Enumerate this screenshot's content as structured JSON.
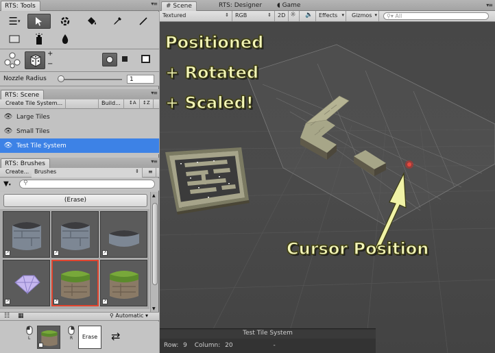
{
  "tools_panel": {
    "tab": "RTS: Tools",
    "nozzle_label": "Nozzle Radius",
    "nozzle_value": "1",
    "nozzle_level": 0.0
  },
  "scene_panel": {
    "tab": "RTS: Scene",
    "create_button": "Create Tile System...",
    "build_button": "Build...",
    "items": [
      {
        "label": "Large Tiles",
        "selected": false
      },
      {
        "label": "Small Tiles",
        "selected": false
      },
      {
        "label": "Test Tile System",
        "selected": true
      }
    ]
  },
  "brushes_panel": {
    "tab": "RTS: Brushes",
    "create_button": "Create...",
    "category_dropdown": "Brushes",
    "erase_button": "(Erase)",
    "view_mode": "Automatic",
    "slot_left_label": "L",
    "slot_right_label": "R",
    "erase_slot_label": "Erase"
  },
  "right_tabs": [
    {
      "label": "Scene",
      "active": true
    },
    {
      "label": "RTS: Designer",
      "active": false
    },
    {
      "label": "Game",
      "active": false
    }
  ],
  "scene_toolbar": {
    "shading": "Textured",
    "channel": "RGB",
    "mode_2d": "2D",
    "effects": "Effects",
    "gizmos": "Gizmos",
    "search_placeholder": "All"
  },
  "captions": {
    "line1": "Positioned",
    "line2": "+ Rotated",
    "line3": "+ Scaled!",
    "cursor": "Cursor Position"
  },
  "status": {
    "title": "Test Tile System",
    "row_label": "Row:",
    "row_value": "9",
    "column_label": "Column:",
    "column_value": "20",
    "extra": "-"
  },
  "colors": {
    "selection": "#3d82e6",
    "caption_fill": "#f4f6b8",
    "brush_selected_outline": "#e2442e",
    "cursor_marker": "#d2302c"
  },
  "icons": [
    "hamburger-menu-icon",
    "pointer-select-icon",
    "paint-brush-icon",
    "bucket-fill-icon",
    "eyedropper-icon",
    "line-tool-icon",
    "rectangle-tool-icon",
    "spray-icon",
    "drop-icon",
    "cycle-icon",
    "dice-icon",
    "plus-icon",
    "minus-icon",
    "radio-icon",
    "square-icon",
    "frame-icon",
    "eye-icon",
    "filter-icon",
    "search-icon",
    "list-view-icon",
    "grid-view-icon",
    "swap-icon",
    "mouse-icon"
  ]
}
